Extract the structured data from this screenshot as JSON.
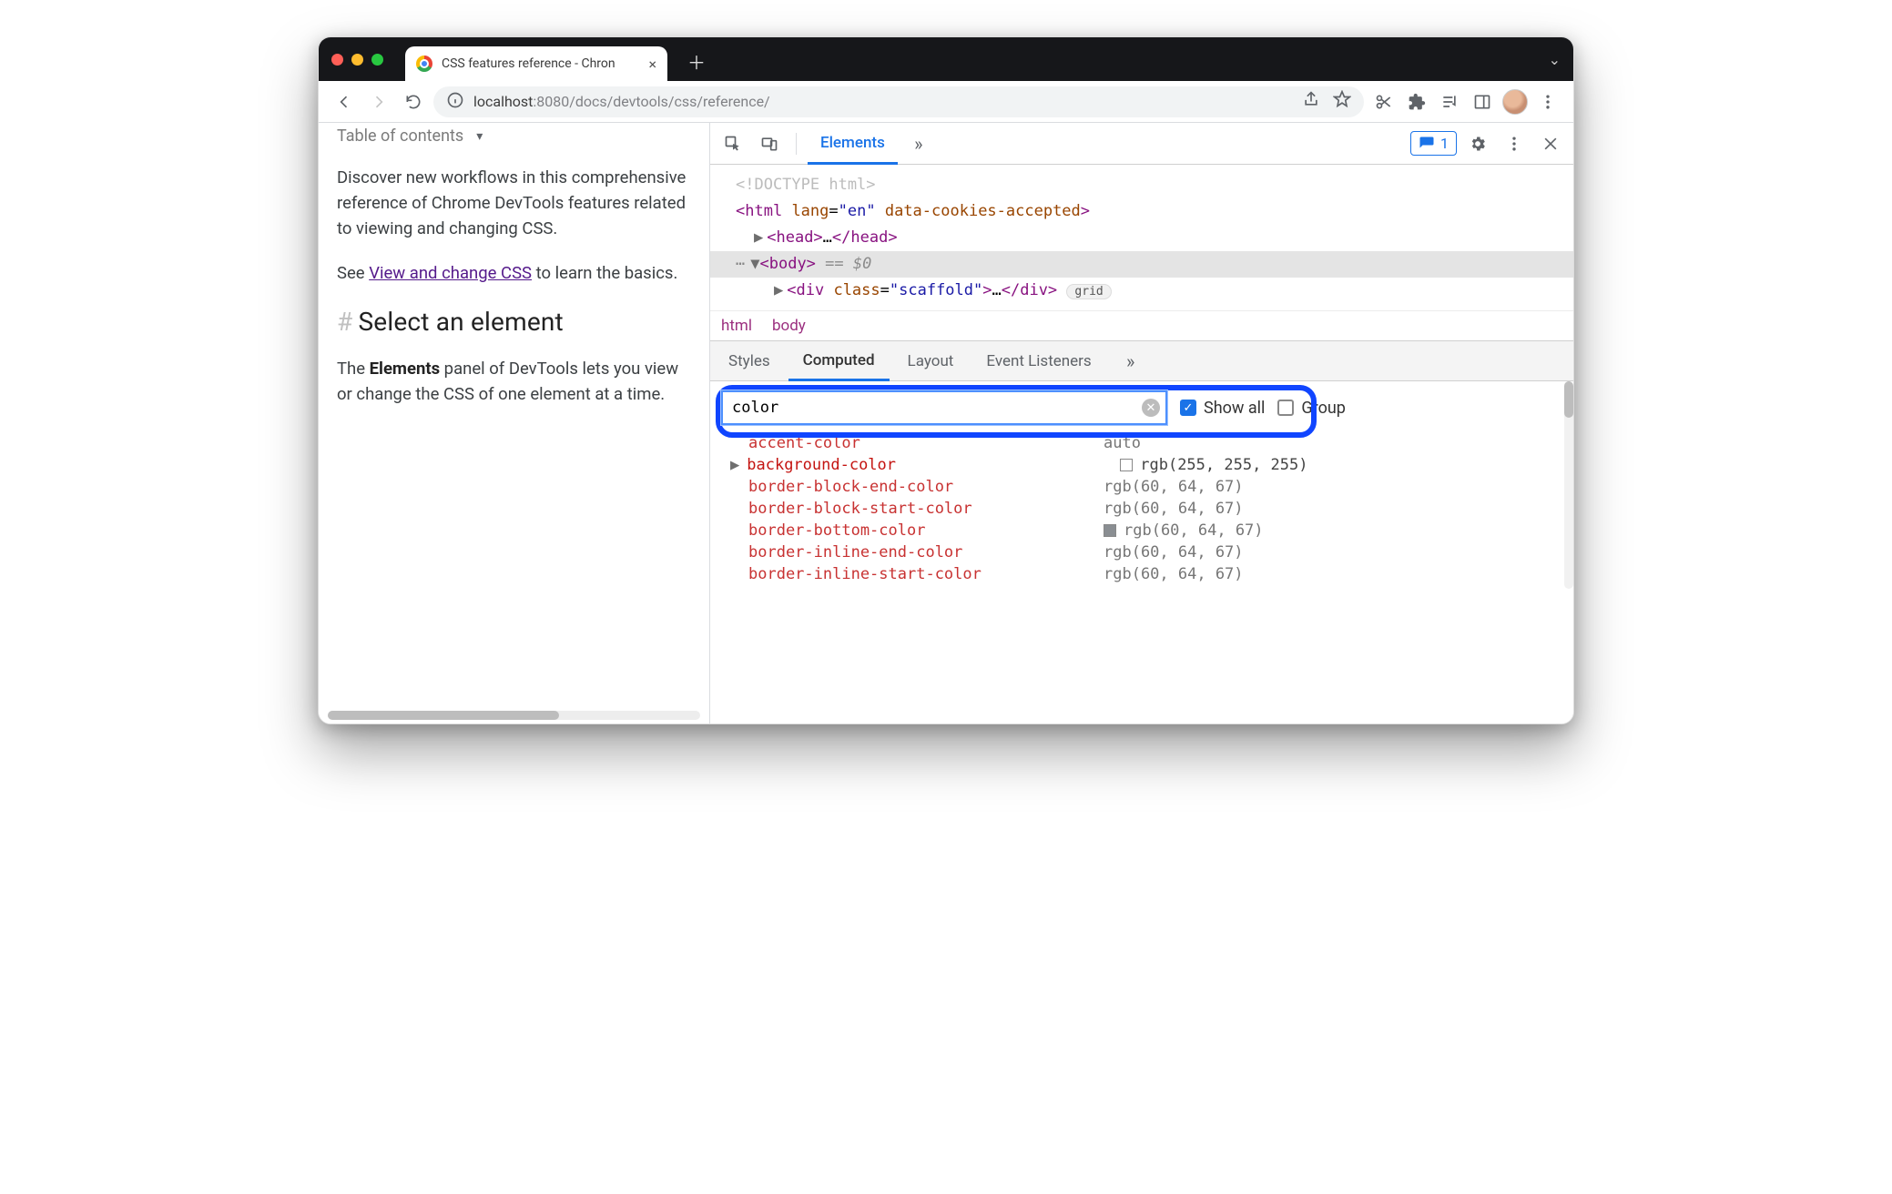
{
  "browser": {
    "tab_title": "CSS features reference - Chron",
    "url_host": "localhost",
    "url_port": ":8080",
    "url_path": "/docs/devtools/css/reference/"
  },
  "page": {
    "toc": "Table of contents",
    "para1": "Discover new workflows in this comprehensive reference of Chrome DevTools features related to viewing and changing CSS.",
    "para2a": "See ",
    "para2_link": "View and change CSS",
    "para2b": " to learn the basics.",
    "heading": "Select an element",
    "para3a": "The ",
    "para3_bold": "Elements",
    "para3b": " panel of DevTools lets you view or change the CSS of one element at a time."
  },
  "devtools": {
    "toolbar": {
      "tab_elements": "Elements",
      "issues_count": "1"
    },
    "dom": {
      "doctype": "<!DOCTYPE html>",
      "html_open": "<html lang=\"en\" data-cookies-accepted>",
      "head": "<head>…</head>",
      "body": "<body>",
      "body_suffix": " == $0",
      "div": "<div class=\"scaffold\">…</div>",
      "grid_badge": "grid",
      "breadcrumb": [
        "html",
        "body"
      ]
    },
    "subtabs": {
      "styles": "Styles",
      "computed": "Computed",
      "layout": "Layout",
      "listeners": "Event Listeners"
    },
    "filter": {
      "value": "color",
      "show_all": "Show all",
      "group": "Group"
    },
    "computed": [
      {
        "expandable": false,
        "prop": "accent-color",
        "val": "auto",
        "swatch": null,
        "dim": true
      },
      {
        "expandable": true,
        "prop": "background-color",
        "val": "rgb(255, 255, 255)",
        "swatch": "#ffffff",
        "dim": false
      },
      {
        "expandable": false,
        "prop": "border-block-end-color",
        "val": "rgb(60, 64, 67)",
        "swatch": null,
        "dim": true
      },
      {
        "expandable": false,
        "prop": "border-block-start-color",
        "val": "rgb(60, 64, 67)",
        "swatch": null,
        "dim": true
      },
      {
        "expandable": false,
        "prop": "border-bottom-color",
        "val": "rgb(60, 64, 67)",
        "swatch": "#8a8e92",
        "dim": true
      },
      {
        "expandable": false,
        "prop": "border-inline-end-color",
        "val": "rgb(60, 64, 67)",
        "swatch": null,
        "dim": true
      },
      {
        "expandable": false,
        "prop": "border-inline-start-color",
        "val": "rgb(60, 64, 67)",
        "swatch": null,
        "dim": true
      }
    ]
  }
}
